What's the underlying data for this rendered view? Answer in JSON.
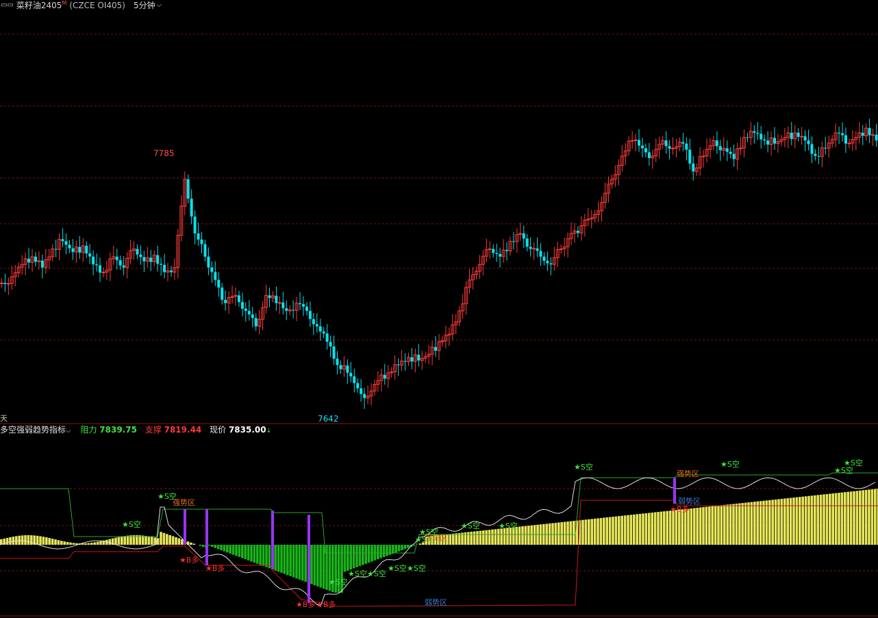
{
  "topbar": {
    "menu_icon": "menu-icon",
    "instrument_name": "菜籽油2405",
    "main_badge": "M",
    "instrument_code": "(CZCE OI405)",
    "period": "5分钟",
    "period_chevron": "chevron-down-icon"
  },
  "main_chart": {
    "high_label": "7785",
    "low_label": "7642",
    "left_tag": "天",
    "colors": {
      "up": "#ff3c3c",
      "down": "#00e5f0",
      "grid": "#7a1515"
    }
  },
  "indicator": {
    "name": "多空强弱趋势指标",
    "chevron": "chevron-down-icon",
    "resistance_label": "阻力",
    "resistance_value": "7839.75",
    "support_label": "支撑",
    "support_value": "7819.44",
    "price_label": "现价",
    "price_value": "7835.00",
    "up_arrow": "↓",
    "zone_strong": "强势区",
    "zone_weak": "弱势区",
    "sell_signal": "★S空",
    "buy_signal": "★B多",
    "colors": {
      "bull": "#e6e65a",
      "bear": "#19b419",
      "signal": "#9933ff",
      "resistance": "#2ca82c",
      "support": "#d01818"
    }
  },
  "chart_data": {
    "type": "candlestick",
    "title": "菜籽油2405 5分钟",
    "annotations": [
      "7785",
      "7642"
    ],
    "close_path": [
      7718,
      7722,
      7730,
      7735,
      7728,
      7740,
      7745,
      7738,
      7742,
      7730,
      7725,
      7735,
      7728,
      7740,
      7732,
      7736,
      7725,
      7728,
      7785,
      7750,
      7735,
      7720,
      7705,
      7710,
      7700,
      7690,
      7710,
      7705,
      7700,
      7705,
      7700,
      7690,
      7680,
      7665,
      7660,
      7650,
      7645,
      7655,
      7660,
      7665,
      7670,
      7668,
      7672,
      7680,
      7685,
      7700,
      7720,
      7730,
      7740,
      7735,
      7745,
      7750,
      7740,
      7735,
      7730,
      7740,
      7750,
      7755,
      7760,
      7770,
      7785,
      7800,
      7810,
      7805,
      7800,
      7810,
      7805,
      7808,
      7790,
      7800,
      7810,
      7805,
      7798,
      7812,
      7815,
      7810,
      7808,
      7812,
      7815,
      7810,
      7800,
      7805,
      7815,
      7808,
      7812,
      7818,
      7810
    ]
  }
}
